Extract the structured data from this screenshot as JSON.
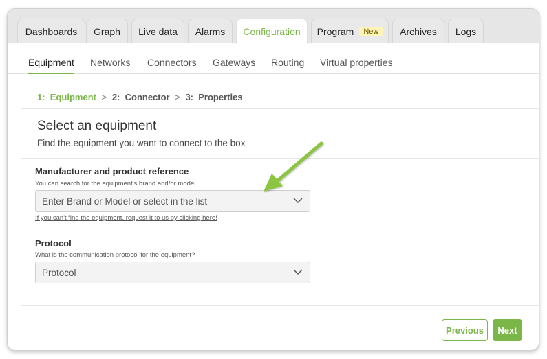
{
  "tabs": [
    {
      "label": "Dashboards"
    },
    {
      "label": "Graph"
    },
    {
      "label": "Live data"
    },
    {
      "label": "Alarms"
    },
    {
      "label": "Configuration"
    },
    {
      "label": "Program",
      "badge": "New"
    },
    {
      "label": "Archives"
    },
    {
      "label": "Logs"
    }
  ],
  "active_tab": "Configuration",
  "subnav": [
    "Equipment",
    "Networks",
    "Connectors",
    "Gateways",
    "Routing",
    "Virtual properties"
  ],
  "active_subnav": "Equipment",
  "steps": [
    {
      "num": "1:",
      "label": "Equipment"
    },
    {
      "num": "2:",
      "label": "Connector"
    },
    {
      "num": "3:",
      "label": "Properties"
    }
  ],
  "step_separator": ">",
  "page": {
    "title": "Select an equipment",
    "subtitle": "Find the equipment you want to connect to the box"
  },
  "manufacturer": {
    "label": "Manufacturer and product reference",
    "hint": "You can search for the equipment's brand and/or model",
    "placeholder": "Enter Brand or Model or select in the list",
    "link": "If you can't find the equipment, request it to us by clicking here!"
  },
  "protocol": {
    "label": "Protocol",
    "hint": "What is the communication protocol for the equipment?",
    "value": "Protocol"
  },
  "buttons": {
    "previous": "Previous",
    "next": "Next"
  },
  "colors": {
    "accent": "#7ab648",
    "badge_bg": "#fff4b8",
    "arrow": "#8cc63f"
  }
}
